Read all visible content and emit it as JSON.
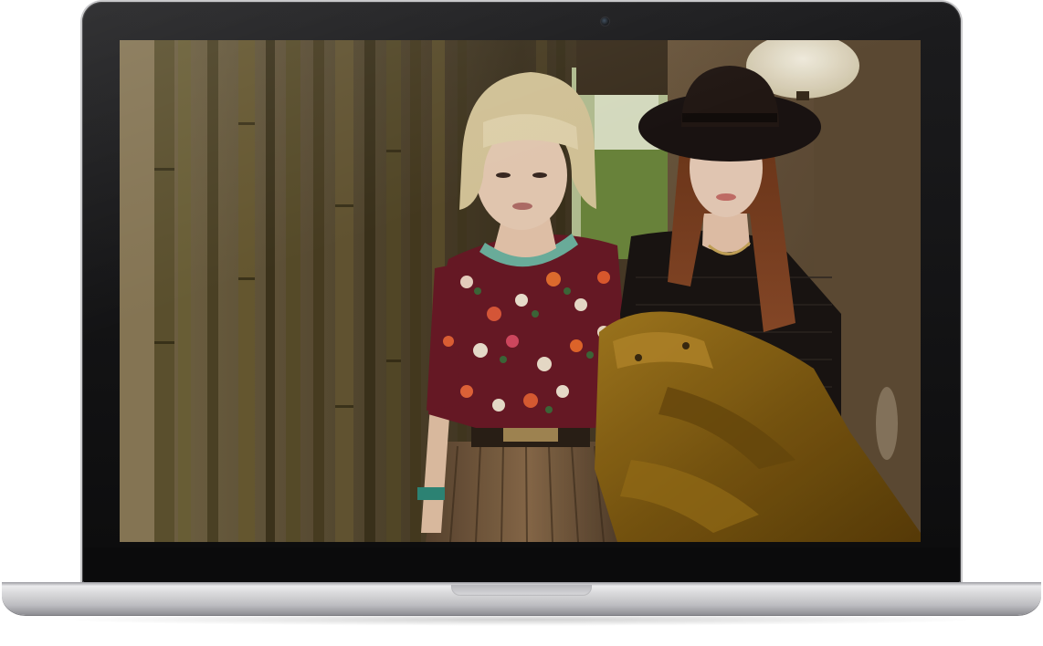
{
  "device": {
    "type": "laptop",
    "bezel_color": "#0c0c0d",
    "body_color": "#d6d6d9"
  },
  "screen": {
    "content": "photograph",
    "palette": {
      "bamboo": "#5a4b2c",
      "wall": "#6f5a3e",
      "dress": "#6b1a26",
      "jacket": "#8a6414",
      "sweater": "#1a1512",
      "hat": "#1b1412",
      "hair_blonde": "#d8c9a0",
      "hair_brown": "#7a3d20",
      "skin": "#e8c7ad",
      "lantern": "#efe7d2",
      "foliage": "#6e8a3e"
    }
  }
}
